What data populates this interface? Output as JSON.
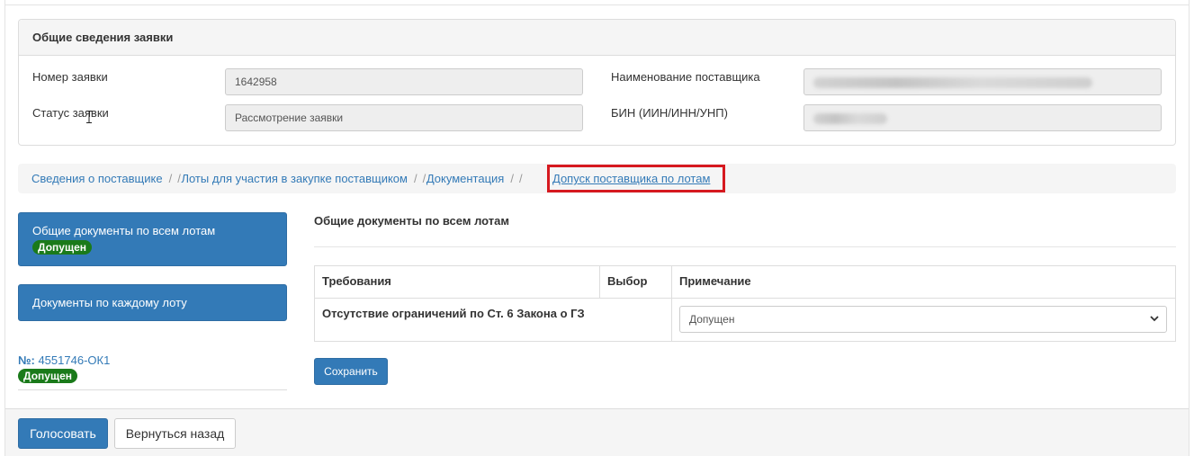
{
  "general_info": {
    "title": "Общие сведения заявки",
    "request_number_label": "Номер заявки",
    "request_number_value": "1642958",
    "status_label": "Статус заявки",
    "status_value": "Рассмотрение заявки",
    "supplier_name_label": "Наименование поставщика",
    "bin_label": "БИН (ИИН/ИНН/УНП)"
  },
  "breadcrumb": {
    "items": [
      "Сведения о поставщике",
      "Лоты для участия в закупке поставщиком",
      "Документация"
    ],
    "active": "Допуск поставщика по лотам",
    "separator": "/"
  },
  "lots": {
    "common_docs_label": "Общие документы по всем лотам",
    "common_docs_badge": "Допущен",
    "per_lot_docs_label": "Документы по каждому лоту",
    "lot_number_prefix": "№:",
    "lot_number": "4551746-ОК1",
    "lot_badge": "Допущен"
  },
  "content": {
    "section_title": "Общие документы по всем лотам",
    "table_headers": [
      "Требования",
      "Выбор",
      "Примечание"
    ],
    "rows": [
      {
        "requirement": "Отсутствие ограничений по Ст. 6 Закона о ГЗ",
        "choice": "",
        "note": "Допущен"
      }
    ],
    "save_label": "Сохранить"
  },
  "footer": {
    "vote_label": "Голосовать",
    "back_label": "Вернуться назад"
  },
  "colors": {
    "primary": "#337ab7",
    "badge_green": "#1a7a1a",
    "highlight_red": "#d6191f"
  }
}
